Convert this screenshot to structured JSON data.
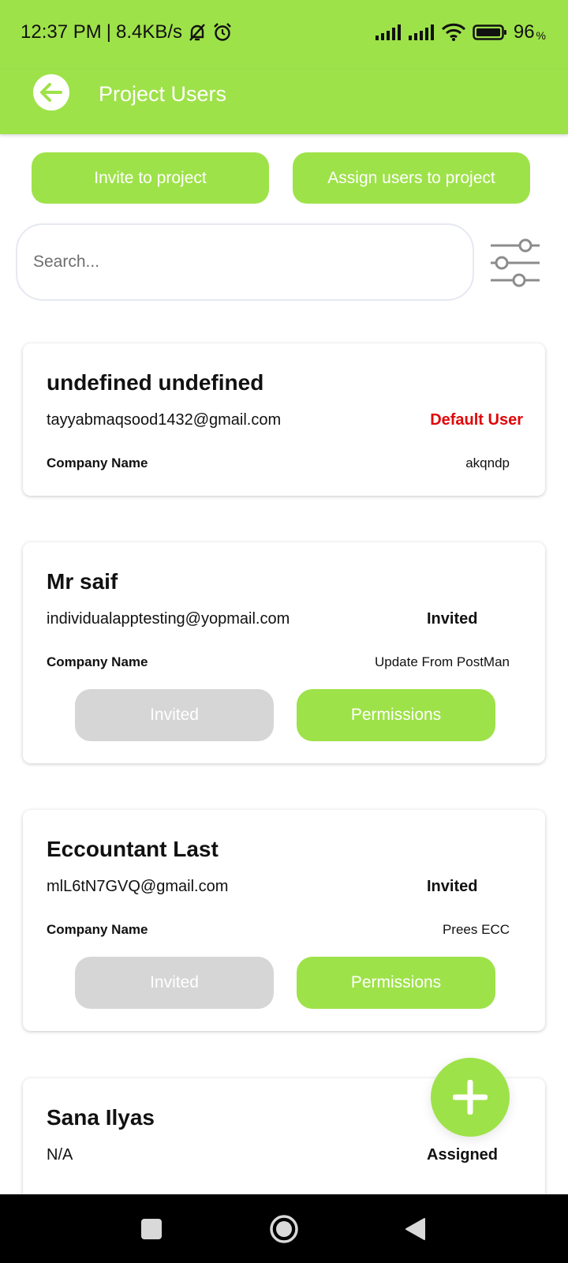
{
  "status_bar": {
    "time": "12:37 PM",
    "separator": "|",
    "network_speed": "8.4KB/s",
    "battery_percent": "96",
    "battery_unit": "%",
    "icons": [
      "mute-bell-icon",
      "alarm-icon",
      "signal-icon",
      "signal-icon",
      "wifi-icon",
      "battery-icon"
    ]
  },
  "header": {
    "title": "Project Users",
    "back_icon": "arrow-left-icon"
  },
  "actions": {
    "invite_label": "Invite to project",
    "assign_label": "Assign users to project"
  },
  "search": {
    "placeholder": "Search...",
    "value": "",
    "filter_icon": "sliders-icon"
  },
  "users": [
    {
      "name": "undefined undefined",
      "email": "tayyabmaqsood1432@gmail.com",
      "status": "Default User",
      "company_label": "Company Name",
      "company_value": "akqndp"
    },
    {
      "name": "Mr saif",
      "email": "individualapptesting@yopmail.com",
      "status": "Invited",
      "company_label": "Company Name",
      "company_value": "Update From PostMan",
      "button_left": "Invited",
      "button_right": "Permissions"
    },
    {
      "name": "Eccountant Last",
      "email": "mlL6tN7GVQ@gmail.com",
      "status": "Invited",
      "company_label": "Company Name",
      "company_value": "Prees ECC",
      "button_left": "Invited",
      "button_right": "Permissions"
    },
    {
      "name": "Sana Ilyas",
      "email": "N/A",
      "status": "Assigned"
    }
  ],
  "fab": {
    "icon": "plus-icon"
  },
  "nav": {
    "icons": [
      "recents-square-icon",
      "home-circle-icon",
      "back-triangle-icon"
    ]
  },
  "colors": {
    "accent": "#9ee249",
    "default_user": "#e0060a",
    "disabled": "#d6d6d6"
  }
}
